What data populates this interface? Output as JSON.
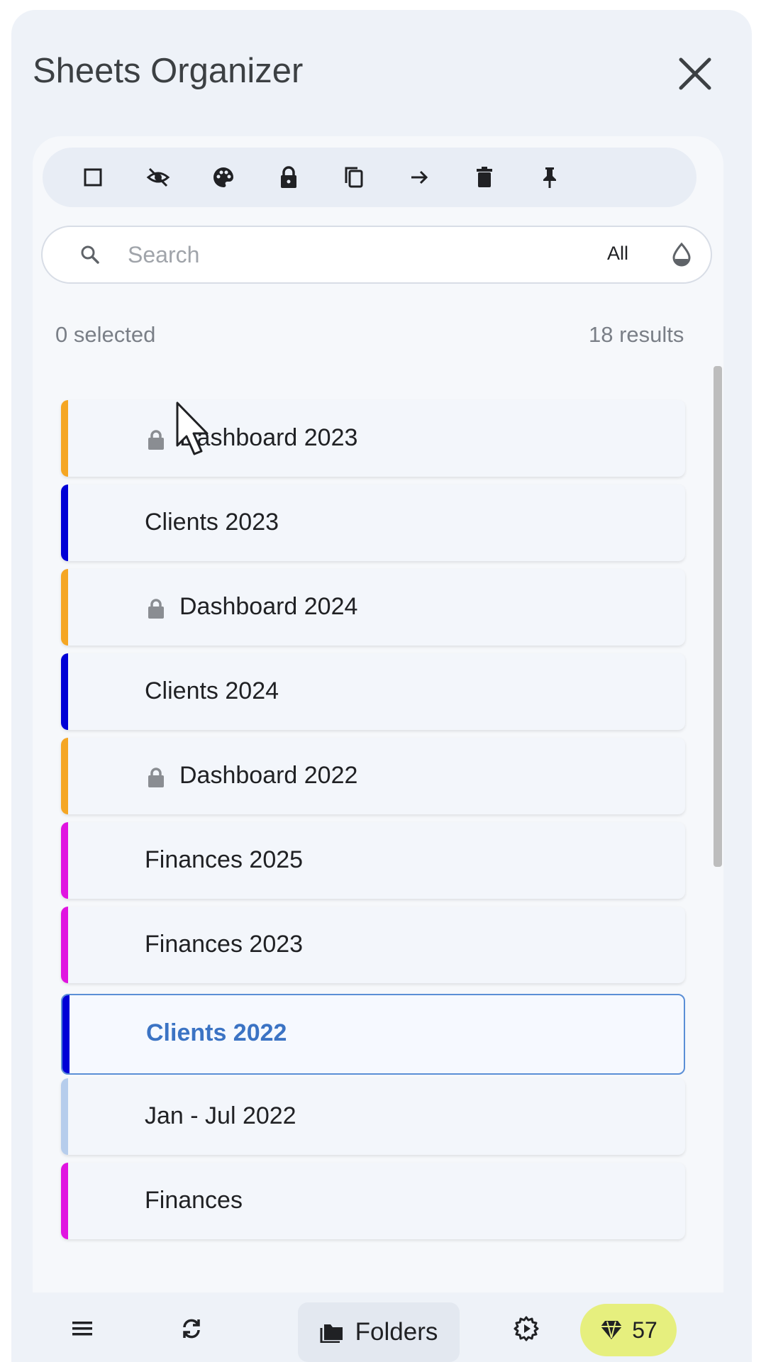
{
  "app": {
    "title": "Sheets Organizer"
  },
  "toolbar": {
    "tools": [
      "checkbox-icon",
      "hide-icon",
      "palette-icon",
      "lock-icon",
      "copy-icon",
      "move-arrow-icon",
      "delete-icon",
      "pin-icon"
    ]
  },
  "search": {
    "placeholder": "Search",
    "value": "",
    "filter_label": "All"
  },
  "status": {
    "selected": "0 selected",
    "results": "18 results"
  },
  "sheets": [
    {
      "name": "Dashboard 2023",
      "locked": true,
      "color": "#f5a623",
      "selected": false
    },
    {
      "name": "Clients 2023",
      "locked": false,
      "color": "#0000d6",
      "selected": false
    },
    {
      "name": "Dashboard 2024",
      "locked": true,
      "color": "#f5a623",
      "selected": false
    },
    {
      "name": "Clients 2024",
      "locked": false,
      "color": "#0000d6",
      "selected": false
    },
    {
      "name": "Dashboard 2022",
      "locked": true,
      "color": "#f5a623",
      "selected": false
    },
    {
      "name": "Finances 2025",
      "locked": false,
      "color": "#e014e0",
      "selected": false
    },
    {
      "name": "Finances 2023",
      "locked": false,
      "color": "#e014e0",
      "selected": false
    },
    {
      "name": "Clients 2022",
      "locked": false,
      "color": "#0000d6",
      "selected": true
    },
    {
      "name": "Jan - Jul 2022",
      "locked": false,
      "color": "#b6cdec",
      "selected": false
    },
    {
      "name": "Finances",
      "locked": false,
      "color": "#e014e0",
      "selected": false
    }
  ],
  "bottom_nav": {
    "folders_label": "Folders",
    "gems_count": "57"
  },
  "colors": {
    "accent": "#3b73c4",
    "gem_badge": "#e6ef7e"
  }
}
